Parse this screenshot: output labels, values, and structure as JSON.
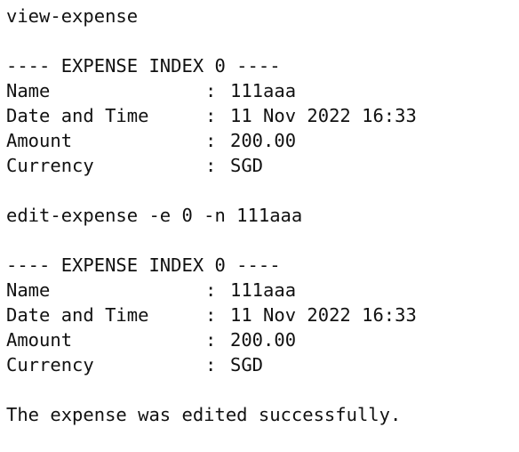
{
  "terminal": {
    "command_1": "view-expense",
    "block_1": {
      "header": "---- EXPENSE INDEX 0 ----",
      "fields": [
        {
          "key": "Name",
          "value": "111aaa"
        },
        {
          "key": "Date and Time",
          "value": "11 Nov 2022 16:33"
        },
        {
          "key": "Amount",
          "value": "200.00"
        },
        {
          "key": "Currency",
          "value": "SGD"
        }
      ]
    },
    "command_2": "edit-expense -e 0 -n 111aaa",
    "block_2": {
      "header": "---- EXPENSE INDEX 0 ----",
      "fields": [
        {
          "key": "Name",
          "value": "111aaa"
        },
        {
          "key": "Date and Time",
          "value": "11 Nov 2022 16:33"
        },
        {
          "key": "Amount",
          "value": "200.00"
        },
        {
          "key": "Currency",
          "value": "SGD"
        }
      ]
    },
    "separator": ":",
    "result": "The expense was edited successfully."
  }
}
